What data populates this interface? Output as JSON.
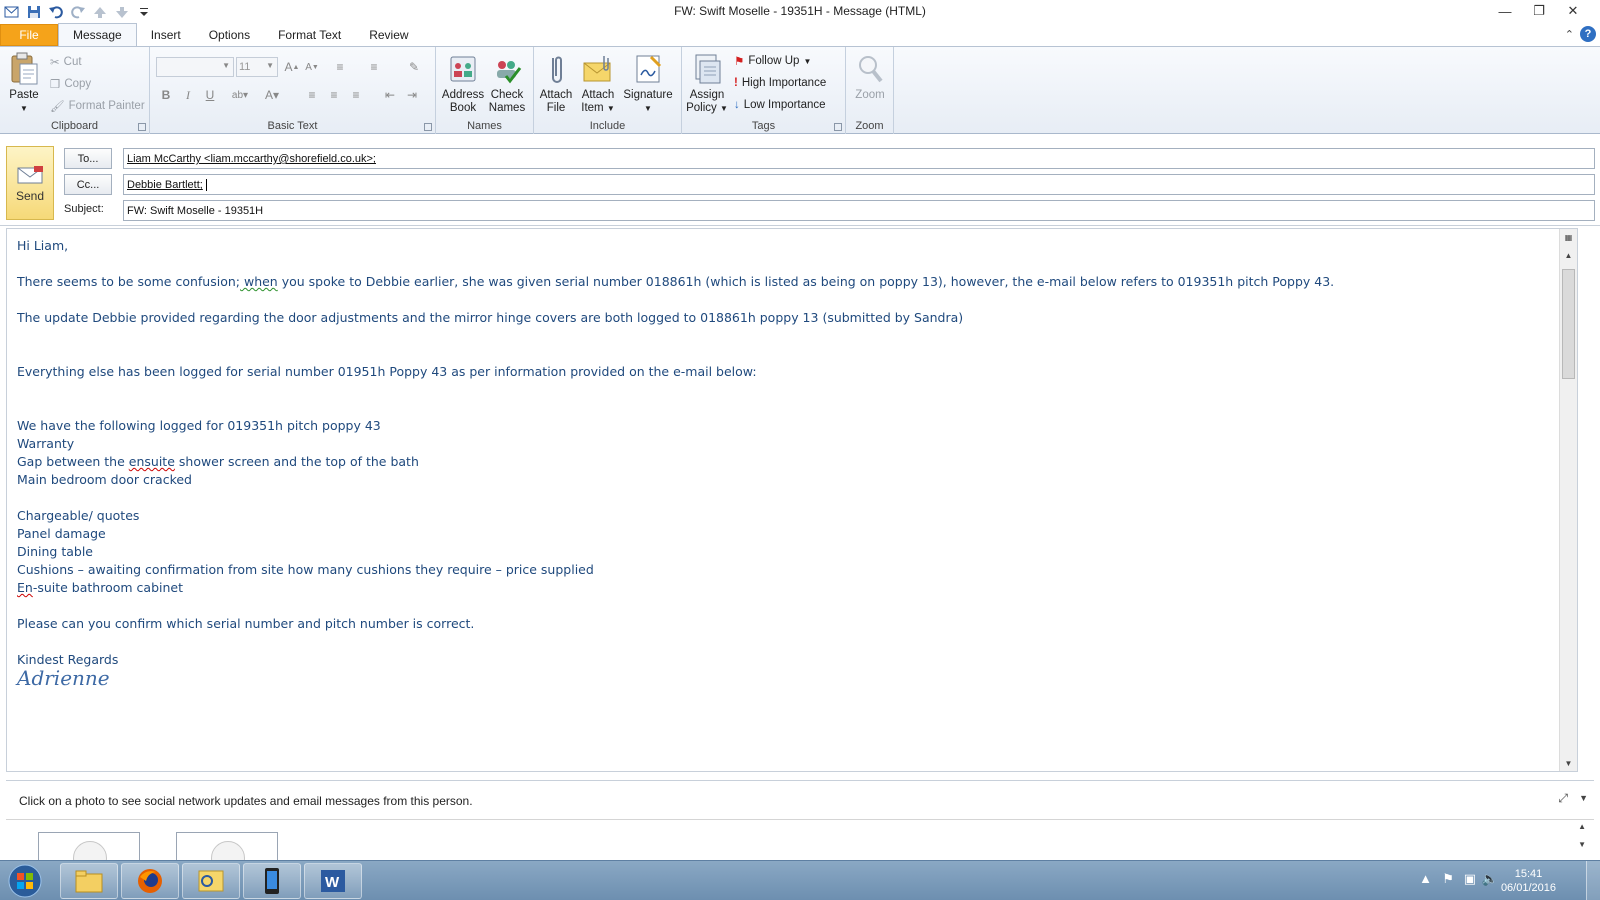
{
  "window": {
    "title": "FW: Swift Moselle - 19351H  -  Message (HTML)"
  },
  "tabs": [
    "File",
    "Message",
    "Insert",
    "Options",
    "Format Text",
    "Review"
  ],
  "ribbon": {
    "clipboard": {
      "paste": "Paste",
      "cut": "Cut",
      "copy": "Copy",
      "format_painter": "Format Painter",
      "label": "Clipboard"
    },
    "basic_text": {
      "font_name": "",
      "font_size": "11",
      "label": "Basic Text"
    },
    "names": {
      "address_book": [
        "Address",
        "Book"
      ],
      "check_names": [
        "Check",
        "Names"
      ],
      "label": "Names"
    },
    "include": {
      "attach_file": [
        "Attach",
        "File"
      ],
      "attach_item": [
        "Attach",
        "Item"
      ],
      "signature": "Signature",
      "label": "Include"
    },
    "tags": {
      "assign_policy": [
        "Assign",
        "Policy"
      ],
      "follow_up": "Follow Up",
      "high_importance": "High Importance",
      "low_importance": "Low Importance",
      "label": "Tags"
    },
    "zoom": {
      "zoom": "Zoom",
      "label": "Zoom"
    }
  },
  "header": {
    "send": "Send",
    "to_label": "To...",
    "to_value": "Liam McCarthy <liam.mccarthy@shorefield.co.uk>;",
    "cc_label": "Cc...",
    "cc_value": "Debbie Bartlett;",
    "subject_label": "Subject:",
    "subject_value": "FW: Swift Moselle - 19351H"
  },
  "body": {
    "greeting": "Hi Liam,",
    "p1_before": "There seems to be some confusion;",
    "p1_squig": " when",
    "p1_after": " you spoke to Debbie earlier, she was given  serial number 018861h (which is  listed as being on poppy 13), however, the e-mail below refers to 019351h pitch Poppy 43.",
    "p2": "The update Debbie provided regarding the door adjustments and the mirror hinge covers are both logged to 018861h poppy 13 (submitted by Sandra)",
    "p3": "Everything else has been logged for serial number 01951h Poppy 43 as per information provided on the e-mail below:",
    "logged_heading": "We have the following logged for 019351h pitch poppy 43",
    "warranty": "Warranty",
    "gap_before": "Gap between the ",
    "gap_squig": "ensuite",
    "gap_after": " shower screen and the top of the bath",
    "door": "Main bedroom door cracked",
    "chargeable": "Chargeable/ quotes",
    "panel": "Panel damage",
    "dining": "Dining table",
    "cushions": "Cushions – awaiting confirmation from site how many cushions they require – price supplied",
    "ensuite_squig": "En",
    "ensuite_rest": "-suite bathroom cabinet",
    "confirm": "Please can you confirm which serial number and pitch number is correct.",
    "regards": "Kindest Regards",
    "signature": "Adrienne"
  },
  "people_pane": {
    "hint": "Click on a photo to see social network updates and email messages from this person."
  },
  "taskbar": {
    "time": "15:41",
    "date": "06/01/2016"
  },
  "colors": {
    "file_tab": "#f5a31a",
    "body_text": "#1f497d",
    "send_button": "#f6d978"
  }
}
